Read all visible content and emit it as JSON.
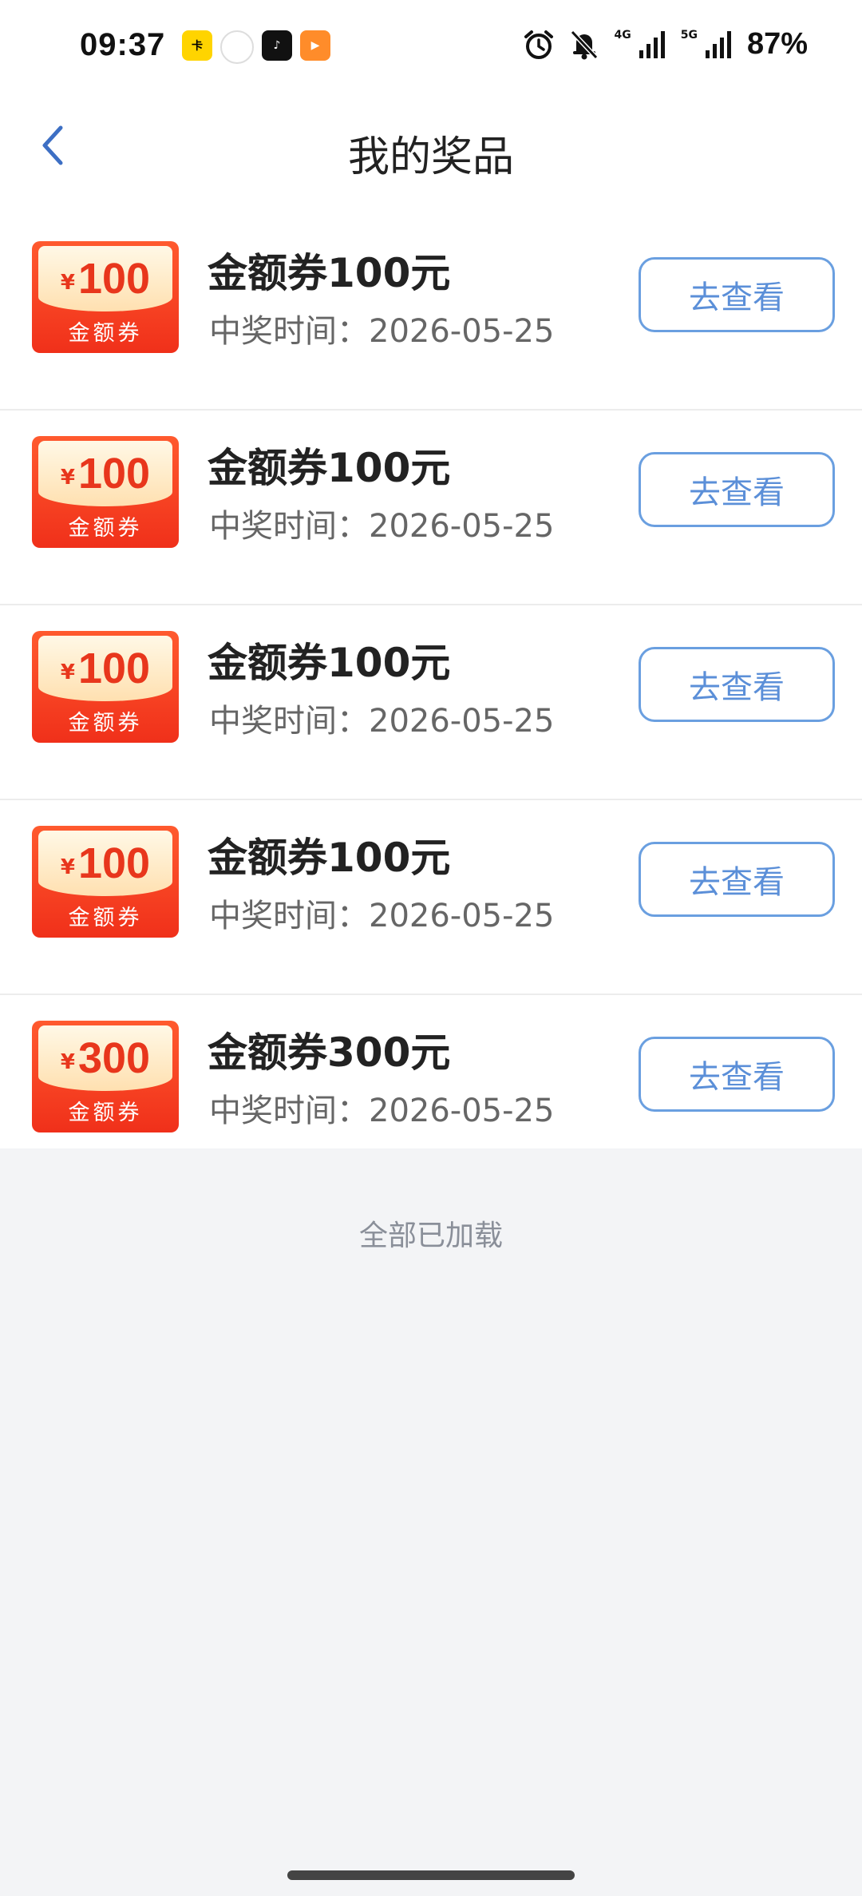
{
  "status_bar": {
    "time": "09:37",
    "app_icons": [
      {
        "name": "app-icon-1",
        "label": "卡"
      },
      {
        "name": "app-icon-2",
        "label": ""
      },
      {
        "name": "app-icon-3",
        "label": "♪"
      },
      {
        "name": "app-icon-4",
        "label": "▶"
      }
    ],
    "network_1": "4G",
    "network_2": "5G",
    "battery": "87%"
  },
  "nav": {
    "title": "我的奖品"
  },
  "prizes": [
    {
      "coupon_symbol": "¥",
      "coupon_amount": "100",
      "coupon_label": "金额券",
      "name": "金额券100元",
      "time": "中奖时间：2026-05-25",
      "button": "去查看"
    },
    {
      "coupon_symbol": "¥",
      "coupon_amount": "100",
      "coupon_label": "金额券",
      "name": "金额券100元",
      "time": "中奖时间：2026-05-25",
      "button": "去查看"
    },
    {
      "coupon_symbol": "¥",
      "coupon_amount": "100",
      "coupon_label": "金额券",
      "name": "金额券100元",
      "time": "中奖时间：2026-05-25",
      "button": "去查看"
    },
    {
      "coupon_symbol": "¥",
      "coupon_amount": "100",
      "coupon_label": "金额券",
      "name": "金额券100元",
      "time": "中奖时间：2026-05-25",
      "button": "去查看"
    },
    {
      "coupon_symbol": "¥",
      "coupon_amount": "300",
      "coupon_label": "金额券",
      "name": "金额券300元",
      "time": "中奖时间：2026-05-25",
      "button": "去查看"
    }
  ],
  "footer": {
    "load_status": "全部已加载"
  },
  "colors": {
    "accent": "#5b8fd8",
    "coupon_red": "#f0301a",
    "background": "#f3f4f6"
  }
}
